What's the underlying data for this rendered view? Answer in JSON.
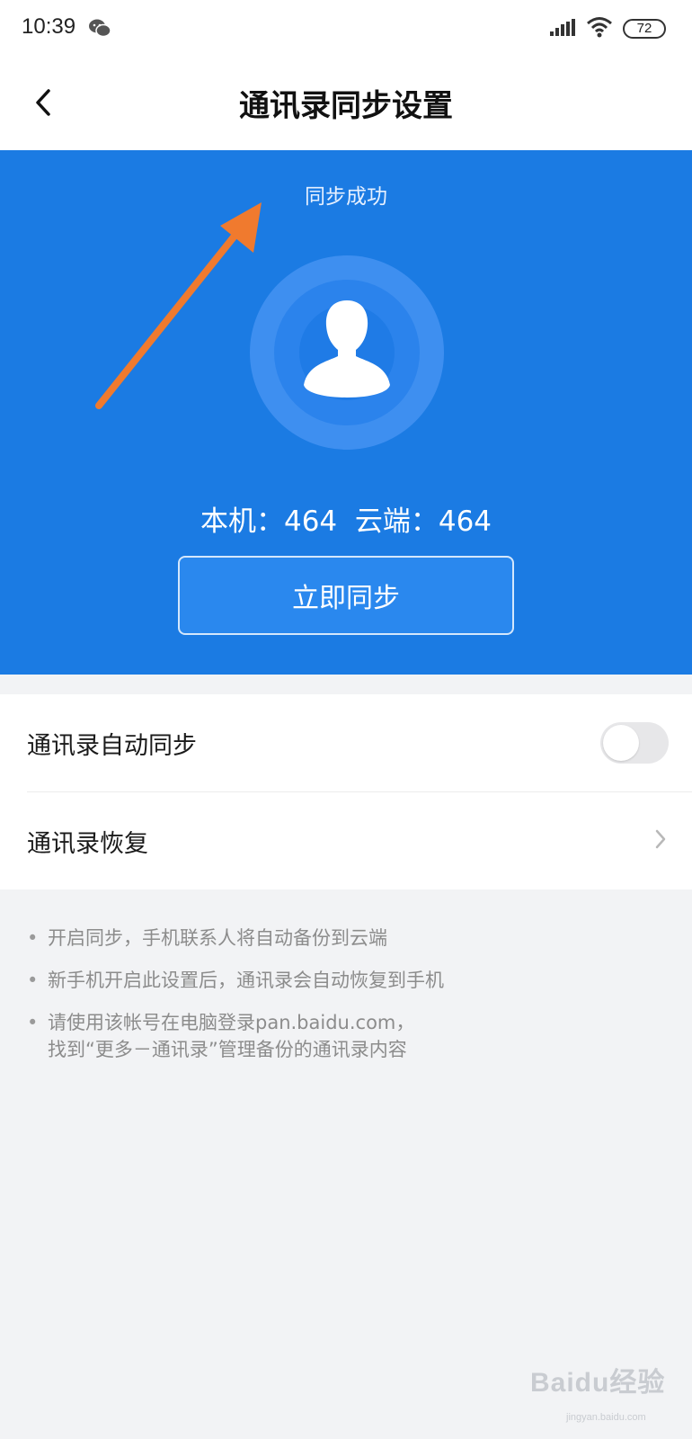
{
  "status_bar": {
    "time": "10:39",
    "battery": "72",
    "icons": [
      "wechat-icon",
      "signal-icon",
      "wifi-icon",
      "battery-icon"
    ]
  },
  "header": {
    "title": "通讯录同步设置",
    "back_icon": "chevron-left-icon"
  },
  "sync_panel": {
    "status": "同步成功",
    "counts": "本机：464  云端：464",
    "sync_button": "立即同步",
    "background_color": "#1b7be3",
    "avatar_icon": "person-avatar-icon",
    "annotation_icon": "orange-arrow-icon"
  },
  "settings": {
    "items": [
      {
        "label": "通讯录自动同步",
        "control": "toggle",
        "enabled": false
      },
      {
        "label": "通讯录恢复",
        "control": "chevron-right-icon"
      }
    ]
  },
  "tips": [
    "开启同步，手机联系人将自动备份到云端",
    "新手机开启此设置后，通讯录会自动恢复到手机",
    "请使用该帐号在电脑登录pan.baidu.com，\n找到“更多－通讯录”管理备份的通讯录内容"
  ],
  "watermark": {
    "text": "Baidu经验",
    "sub": "jingyan.baidu.com"
  }
}
